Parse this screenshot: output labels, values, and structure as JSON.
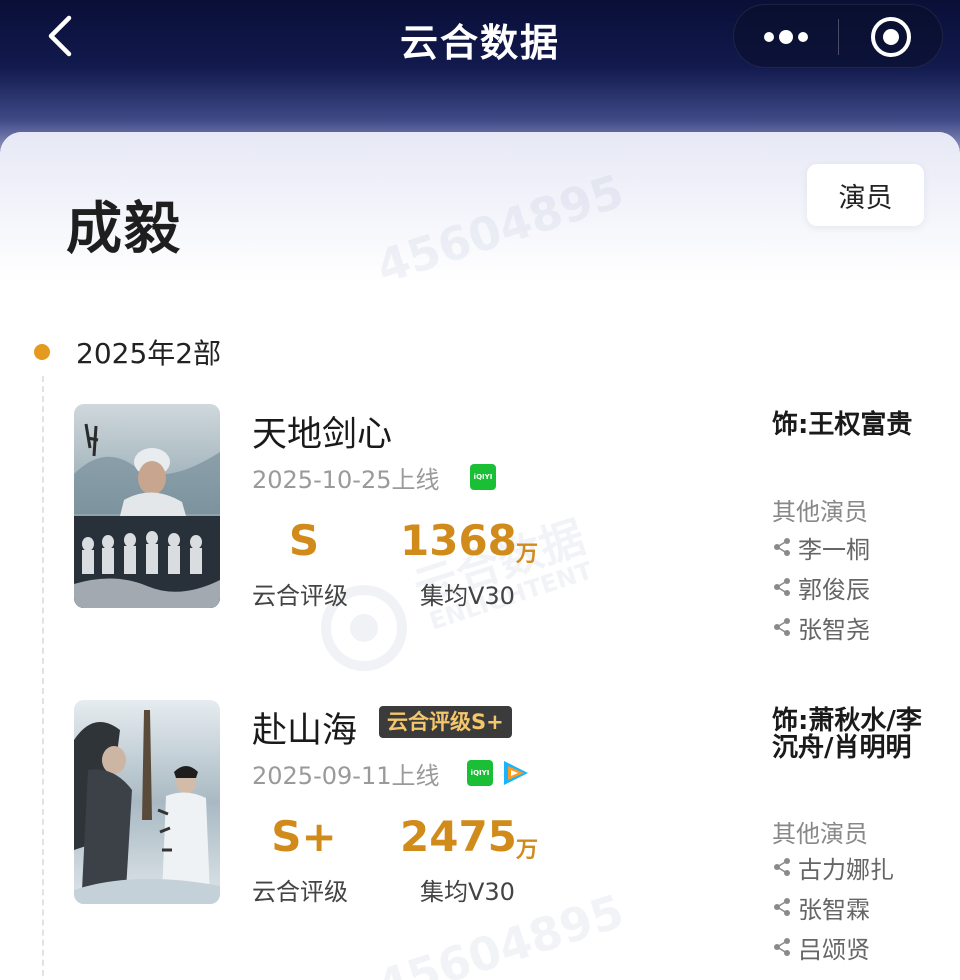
{
  "app": {
    "title": "云合数据"
  },
  "person": {
    "name": "成毅",
    "role": "演员"
  },
  "watermark": {
    "text": "45604895",
    "brand": "云合数据",
    "brand_en": "ENLIGHTENT"
  },
  "timeline": {
    "year_label": "2025年2部"
  },
  "shows": [
    {
      "title": "天地剑心",
      "air_date": "2025-10-25上线",
      "platforms": [
        "iqiyi-icon"
      ],
      "rating": "S",
      "rating_label": "云合评级",
      "views": "1368",
      "views_unit": "万",
      "views_label": "集均V30",
      "role": "饰:王权富贵",
      "other_actors_label": "其他演员",
      "other_actors": [
        "李一桐",
        "郭俊辰",
        "张智尧"
      ]
    },
    {
      "title": "赴山海",
      "grade_tag": "云合评级S+",
      "air_date": "2025-09-11上线",
      "platforms": [
        "iqiyi-icon",
        "tencent-video-icon"
      ],
      "rating": "S+",
      "rating_label": "云合评级",
      "views": "2475",
      "views_unit": "万",
      "views_label": "集均V30",
      "role": "饰:萧秋水/李沉舟/肖明明",
      "other_actors_label": "其他演员",
      "other_actors": [
        "古力娜扎",
        "张智霖",
        "吕颂贤"
      ]
    }
  ],
  "icons": {
    "back": "chevron-left-icon",
    "more": "more-dots-icon",
    "close": "target-circle-icon",
    "share": "share-node-icon",
    "iqiyi_text": "iQIYI"
  },
  "colors": {
    "header_dark": "#0a0f37",
    "accent_gold": "#d18b1a",
    "timeline_dot": "#e39a1f",
    "iqiyi_green": "#1bbf36",
    "grade_tag_bg": "#3b3b3b",
    "grade_tag_text": "#f3c76a"
  }
}
